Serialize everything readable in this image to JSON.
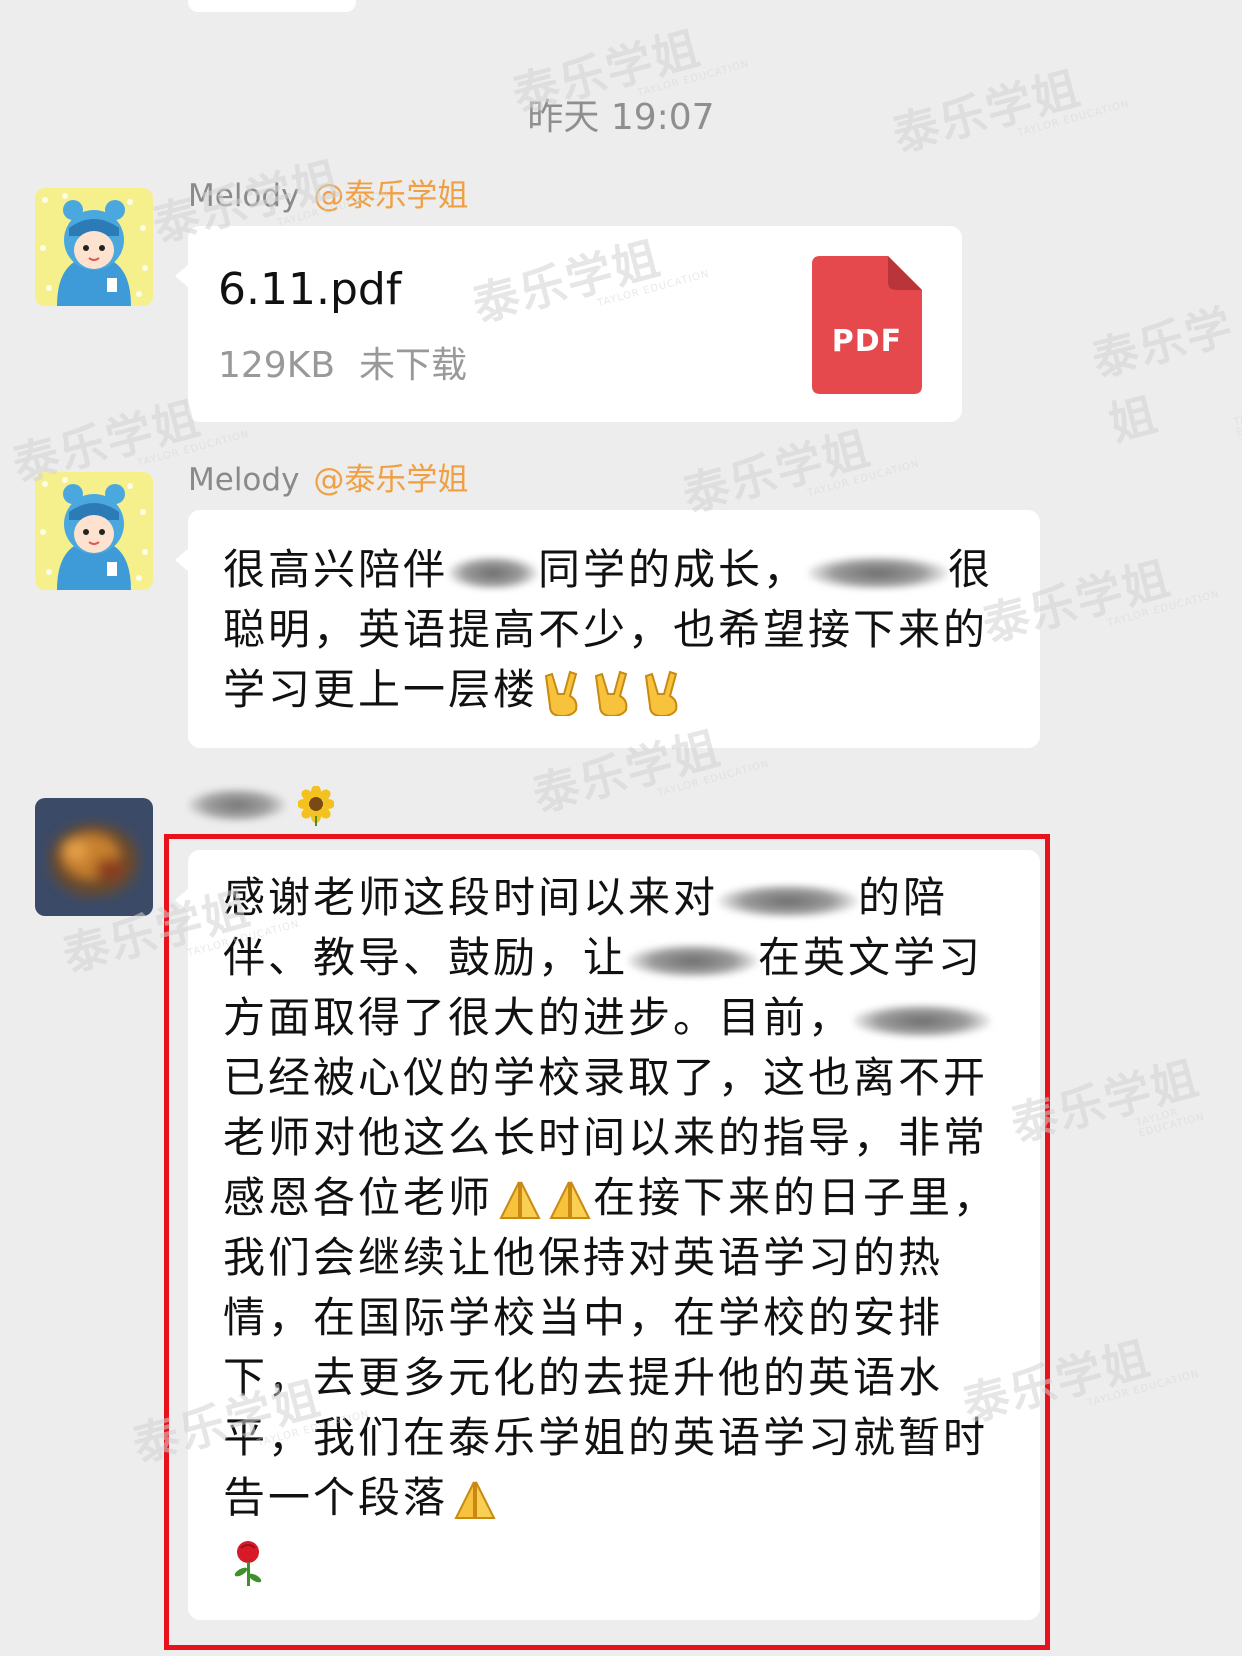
{
  "timestamp": "昨天 19:07",
  "watermark": {
    "text": "泰乐学姐",
    "sub": "TAYLOR EDUCATION"
  },
  "messages": [
    {
      "sender": "Melody",
      "mention": "@泰乐学姐",
      "type": "file",
      "file": {
        "name": "6.11.pdf",
        "size": "129KB",
        "status": "未下载",
        "icon_label": "PDF",
        "icon_color": "#e5484d"
      }
    },
    {
      "sender": "Melody",
      "mention": "@泰乐学姐",
      "type": "text",
      "parts": {
        "p1": "很高兴陪伴",
        "p2": "同学的成长，",
        "p3": "很聪明，英语提高不少，也希望接下来的学习更上一层楼"
      }
    },
    {
      "sender_decor": "sunflower-emoji",
      "type": "text",
      "highlighted": true,
      "highlight_color": "#e8111c",
      "parts": {
        "p1": "感谢老师这段时间以来对",
        "p2": "的陪伴、教导、鼓励，让",
        "p3": "在英文学习方面取得了很大的进步。目前，",
        "p4": "已经被心仪的学校录取了，这也离不开老师对他这么长时间以来的指导，非常感恩各位老师",
        "p5": "在接下来的日子里，我们会继续让他保持对英语学习的热情，在国际学校当中，在学校的安排下，去更多元化的去提升他的英语水平，我们在泰乐学姐的英语学习就暂时告一个段落"
      }
    }
  ]
}
